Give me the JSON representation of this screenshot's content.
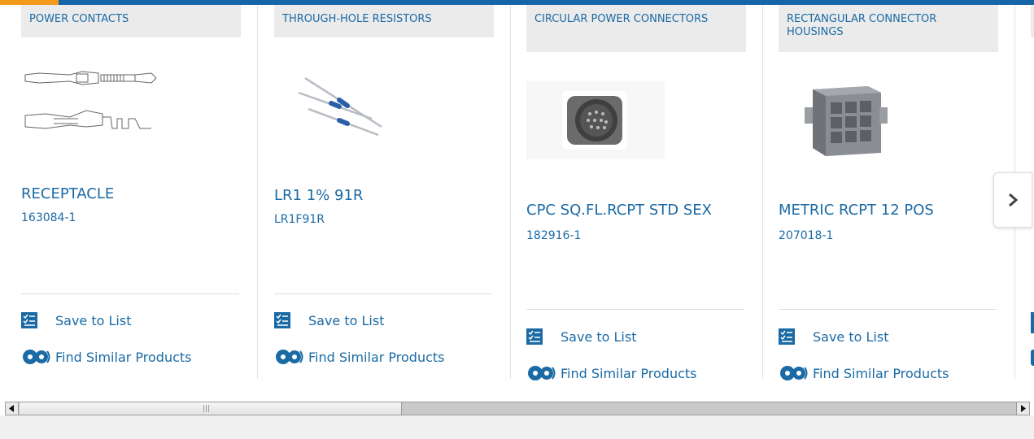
{
  "colors": {
    "brand_blue": "#1a6aa5",
    "accent_orange": "#f39a1d",
    "category_bg": "#ebebeb"
  },
  "cards": [
    {
      "category": "POWER CONTACTS",
      "title": "RECEPTACLE",
      "part_number": "163084-1",
      "save_label": "Save to List",
      "similar_label": "Find Similar Products"
    },
    {
      "category": "THROUGH-HOLE RESISTORS",
      "title": "LR1 1% 91R",
      "part_number": "LR1F91R",
      "save_label": "Save to List",
      "similar_label": "Find Similar Products"
    },
    {
      "category": "CIRCULAR POWER CONNECTORS",
      "title": "CPC SQ.FL.RCPT STD SEX",
      "part_number": "182916-1",
      "save_label": "Save to List",
      "similar_label": "Find Similar Products"
    },
    {
      "category": "RECTANGULAR CONNECTOR HOUSINGS",
      "title": "METRIC RCPT 12 POS",
      "part_number": "207018-1",
      "save_label": "Save to List",
      "similar_label": "Find Similar Products"
    }
  ],
  "icons": {
    "save": "checklist-icon",
    "similar": "gears-icon",
    "next": "chevron-right-icon"
  }
}
